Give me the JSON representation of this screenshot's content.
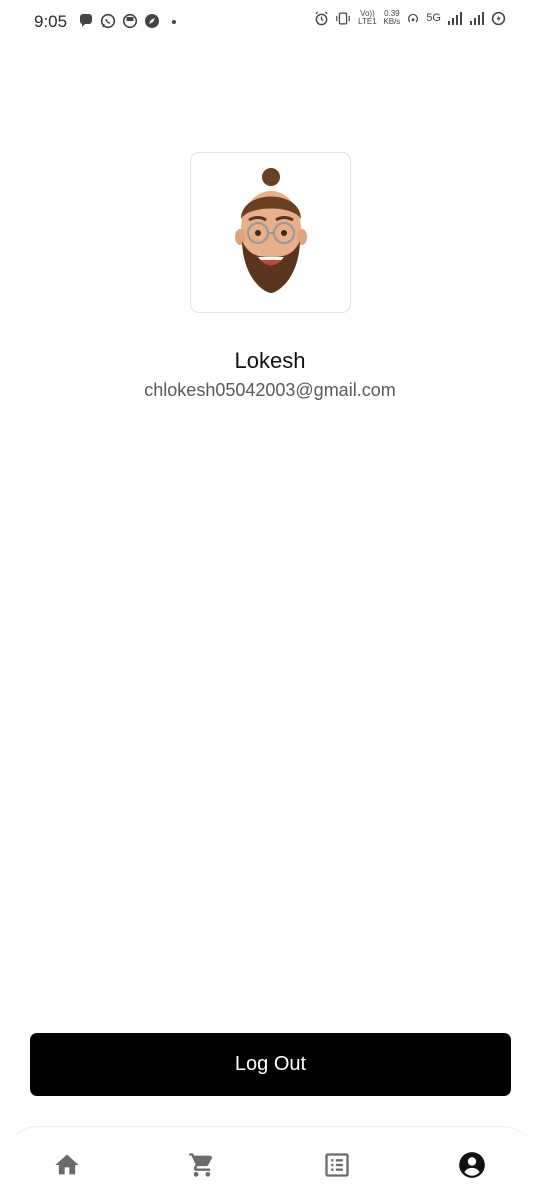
{
  "status_bar": {
    "time": "9:05",
    "network_label": "Vo)) LTE1",
    "speed_value": "0.39",
    "speed_unit": "KB/s",
    "network_type": "5G",
    "left_icons": [
      "chat-bubble-icon",
      "whatsapp-icon",
      "app-notification-icon",
      "compass-icon",
      "more-dot-icon"
    ],
    "right_icons": [
      "alarm-icon",
      "vibrate-icon",
      "hotspot-icon",
      "signal-icon",
      "signal-icon",
      "battery-saver-icon"
    ]
  },
  "profile": {
    "avatar": "memoji-avatar",
    "name": "Lokesh",
    "email": "chlokesh05042003@gmail.com"
  },
  "actions": {
    "logout_label": "Log Out"
  },
  "bottom_nav": {
    "items": [
      "home-icon",
      "cart-icon",
      "list-icon",
      "account-icon"
    ],
    "active": "account-icon"
  },
  "colors": {
    "button_background": "#000000",
    "button_text": "#ffffff",
    "email_text": "#5a5a5a",
    "nav_icon": "#6b6b6b",
    "nav_icon_active": "#111111"
  }
}
